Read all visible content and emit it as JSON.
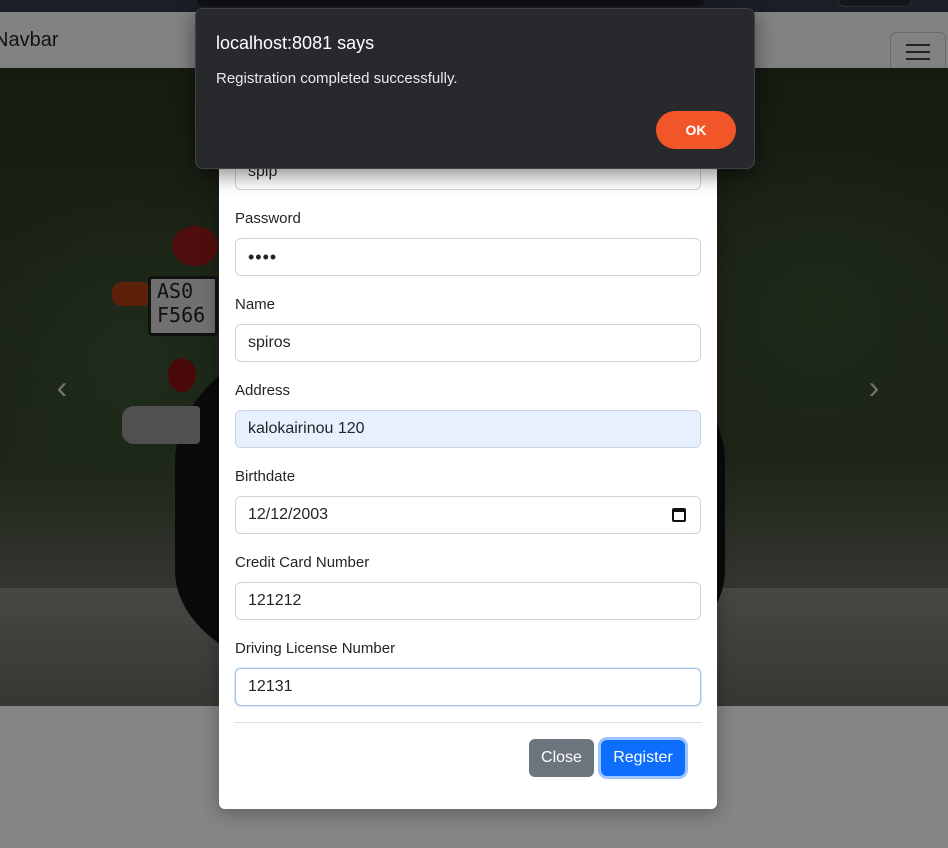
{
  "navbar": {
    "brand": "Navbar",
    "toggler_icon": "hamburger-icon"
  },
  "carousel": {
    "plate_line1": "AS0",
    "plate_line2": "F566",
    "prev_icon": "chevron-left-icon",
    "next_icon": "chevron-right-icon"
  },
  "form": {
    "username": {
      "value": "spip"
    },
    "password": {
      "label": "Password",
      "value": "••••"
    },
    "name": {
      "label": "Name",
      "value": "spiros"
    },
    "address": {
      "label": "Address",
      "value": "kalokairinou 120"
    },
    "birthdate": {
      "label": "Birthdate",
      "value": "12/12/2003"
    },
    "credit_card": {
      "label": "Credit Card Number",
      "value": "121212"
    },
    "driving_license": {
      "label": "Driving License Number",
      "value": "12131"
    }
  },
  "footer": {
    "close_label": "Close",
    "register_label": "Register"
  },
  "alert": {
    "title": "localhost:8081 says",
    "message": "Registration completed successfully.",
    "ok_label": "OK",
    "ok_color": "#f25527"
  },
  "colors": {
    "primary": "#0d6efd",
    "secondary": "#6c757d",
    "autofill": "#e8f0fe",
    "alert_bg": "#27292d"
  }
}
